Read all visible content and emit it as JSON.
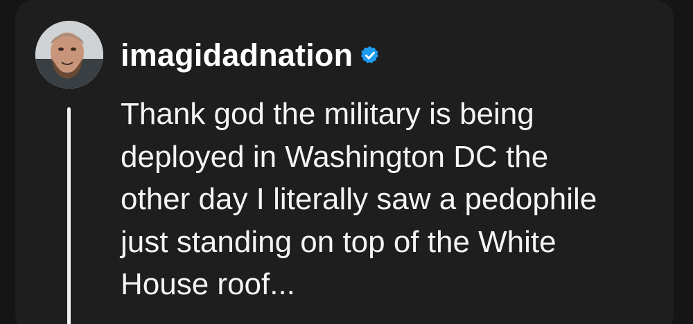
{
  "post": {
    "username": "imagidadnation",
    "verified": true,
    "verified_icon": "verified-badge-icon",
    "text": "Thank god the military is being\ndeployed in Washington DC the\nother day I literally saw a pedophile\njust standing on top of the White\nHouse roof..."
  },
  "colors": {
    "background": "#151515",
    "card": "#1e1e1e",
    "text": "#f4f4f4",
    "verified_badge": "#1d9bf0"
  }
}
